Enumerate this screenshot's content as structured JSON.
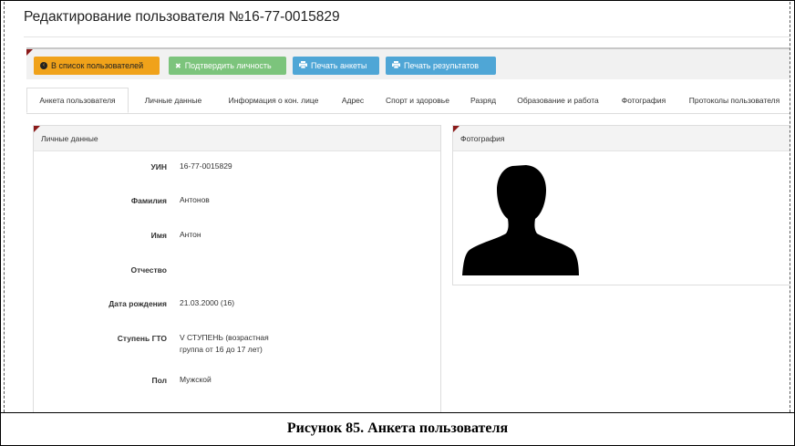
{
  "page_title": "Редактирование пользователя №16-77-0015829",
  "toolbar": {
    "back_label": "В список пользователей",
    "confirm_label": "Подтвердить личность",
    "print_form_label": "Печать анкеты",
    "print_results_label": "Печать результатов",
    "colors": {
      "warning": "#f0a21a",
      "success": "#7cc47c",
      "info": "#4fa6d6"
    }
  },
  "tabs": [
    "Анкета пользователя",
    "Личные данные",
    "Информация о кон. лице",
    "Адрес",
    "Спорт и здоровье",
    "Разряд",
    "Образование и работа",
    "Фотография",
    "Протоколы пользователя"
  ],
  "personal_panel": {
    "title": "Личные данные",
    "fields": [
      {
        "label": "УИН",
        "value": "16-77-0015829"
      },
      {
        "label": "Фамилия",
        "value": "Антонов"
      },
      {
        "label": "Имя",
        "value": "Антон"
      },
      {
        "label": "Отчество",
        "value": ""
      },
      {
        "label": "Дата рождения",
        "value": "21.03.2000 (16)"
      },
      {
        "label": "Ступень ГТО",
        "value": "V СТУПЕНЬ (возрастная группа от 16 до 17 лет)"
      },
      {
        "label": "Пол",
        "value": "Мужской"
      }
    ]
  },
  "photo_panel": {
    "title": "Фотография",
    "photo_icon": "person-silhouette-icon"
  },
  "caption": "Рисунок 85. Анкета пользователя"
}
